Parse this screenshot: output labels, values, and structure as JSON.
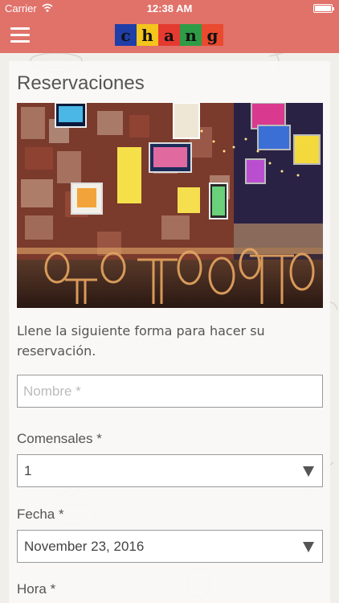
{
  "status_bar": {
    "carrier": "Carrier",
    "time": "12:38 AM",
    "battery_level": 1.0
  },
  "nav": {
    "menu_icon": "hamburger-icon",
    "logo_letters": [
      "c",
      "h",
      "a",
      "n",
      "g"
    ],
    "logo_colors": [
      "#1f3ea8",
      "#f4c51c",
      "#e53a30",
      "#2e9c47",
      "#ea4a2e"
    ]
  },
  "page": {
    "title": "Reservaciones",
    "intro": "Llene la siguiente forma para hacer su reservación."
  },
  "form": {
    "name": {
      "placeholder": "Nombre *",
      "value": ""
    },
    "guests": {
      "label": "Comensales *",
      "value": "1"
    },
    "date": {
      "label": "Fecha *",
      "value": "November 23, 2016"
    },
    "time": {
      "label": "Hora *"
    }
  },
  "colors": {
    "brand": "#e0726a",
    "background": "#f1efea"
  }
}
